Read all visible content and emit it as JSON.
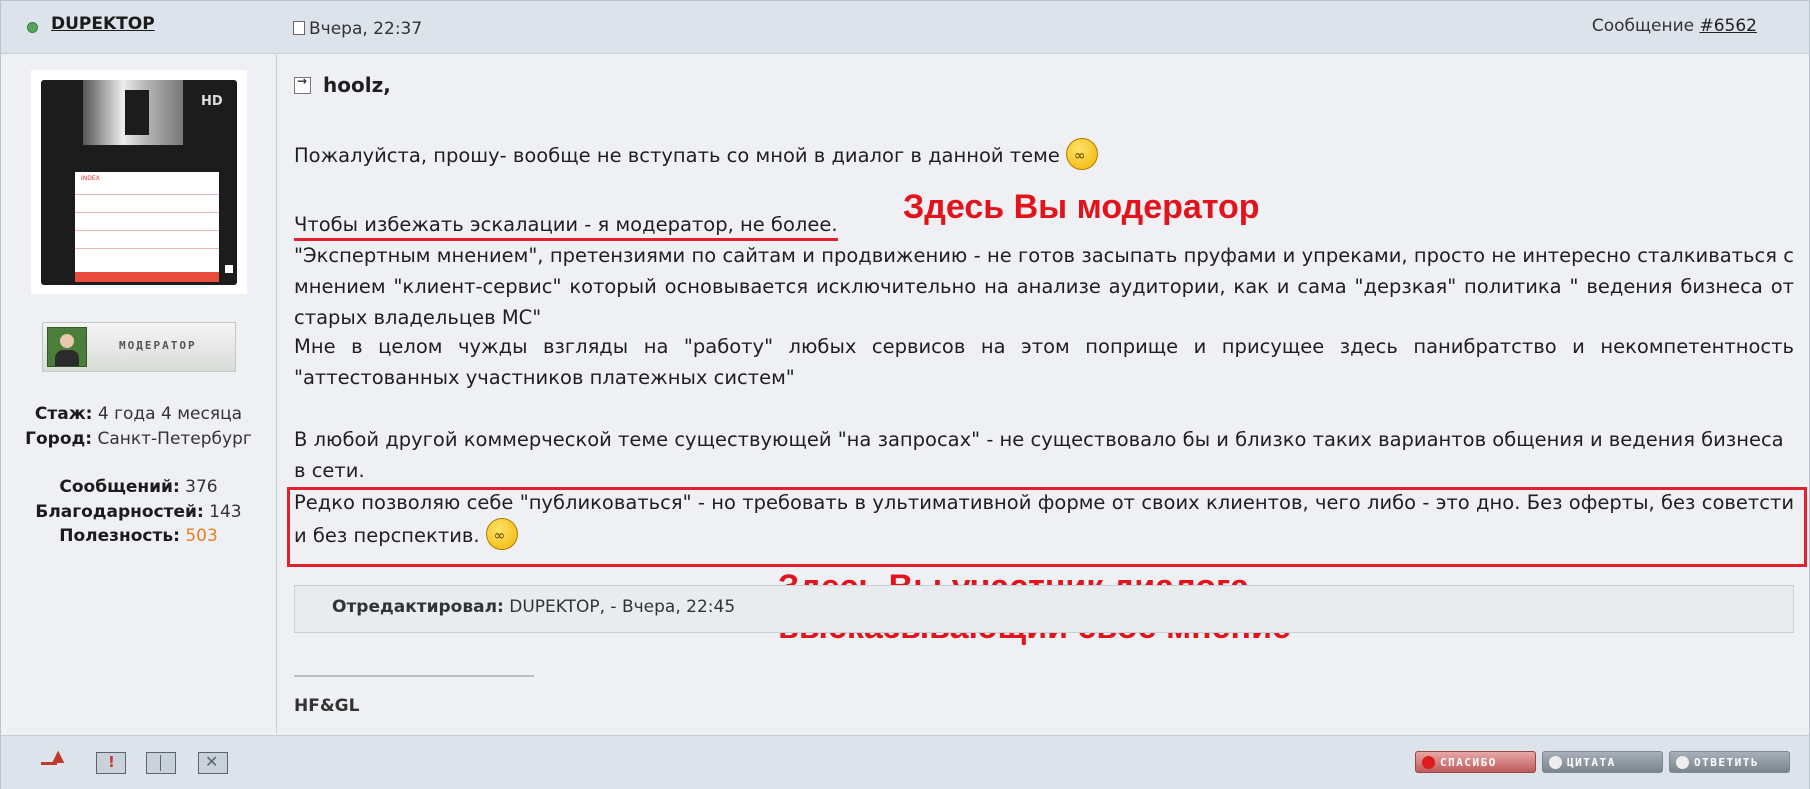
{
  "post": {
    "username": "DUPEKTOP",
    "date": "Вчера, 22:37",
    "message_label": "Сообщение",
    "message_number": "#6562",
    "author": {
      "rank_label": "МОДЕРАТОР",
      "stats": [
        {
          "label": "Стаж:",
          "value": "4 года 4 месяца"
        },
        {
          "label": "Город:",
          "value": "Санкт-Петербург"
        },
        {
          "label": "Сообщений:",
          "value": "376"
        },
        {
          "label": "Благодарностей:",
          "value": "143"
        },
        {
          "label": "Полезность:",
          "value": "503"
        }
      ]
    },
    "addressee": "hoolz,",
    "paragraphs": [
      "Пожалуйста, прошу- вообще не вступать со мной в диалог в данной теме",
      "Чтобы избежать эскалации - я модератор, не более.",
      "\"Экспертным мнением\", претензиями по сайтам и продвижению - не готов засыпать пруфами и упреками, просто не интересно сталкиваться с мнением \"клиент-сервис\" который основывается исключительно на анализе аудитории, как и сама \"дерзкая\" политика \" ведения бизнеса от старых владельцев МС\"",
      "Мне в целом чужды взгляды на \"работу\" любых сервисов на этом поприще и присущее здесь панибратство и некомпетентность \"аттестованных участников платежных систем\"",
      "В любой другой коммерческой теме существующей \"на запросах\" - не существовало бы и близко таких вариантов общения и ведения бизнеса в сети.",
      "Редко позволяю себе \"публиковаться\" - но требовать в ультимативной форме от своих клиентов, чего либо - это дно. Без оферты, без советсти и без перспектив."
    ],
    "annotations": {
      "moderator": "Здесь Вы модератор",
      "participant_line1": "Здесь Вы участник диалога,",
      "participant_line2": "высказывающий своё мнение"
    },
    "edited": {
      "label": "Отредактировал:",
      "value": "DUPEKTOP, - Вчера, 22:45"
    },
    "signature": "HF&GL",
    "buttons": {
      "thanks": "СПАСИБО",
      "quote": "ЦИТАТА",
      "reply": "ОТВЕТИТЬ"
    }
  },
  "colors": {
    "annotation_red": "#e3131b",
    "usefulness_orange": "#e8801f",
    "header_bg": "#dde3ea",
    "body_bg": "#eef0f3"
  }
}
